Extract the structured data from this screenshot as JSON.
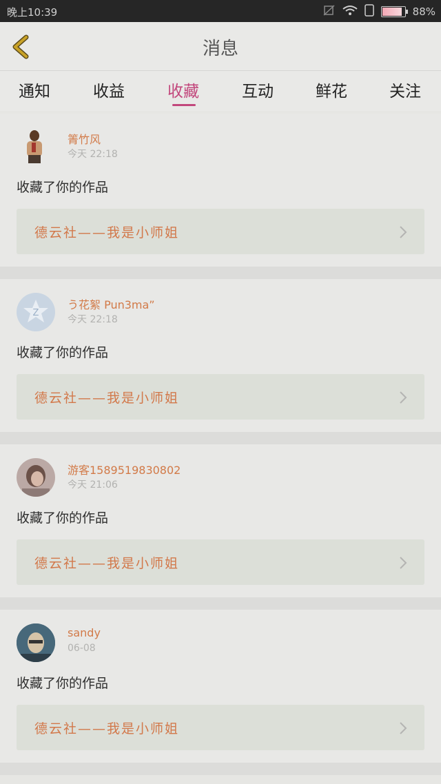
{
  "status_bar": {
    "time": "晚上10:39",
    "battery": "88%",
    "battery_level": 0.88
  },
  "header": {
    "title": "消息"
  },
  "tabs": [
    {
      "label": "通知"
    },
    {
      "label": "收益"
    },
    {
      "label": "收藏",
      "active": true
    },
    {
      "label": "互动"
    },
    {
      "label": "鲜花"
    },
    {
      "label": "关注"
    }
  ],
  "messages": [
    {
      "user": "箐竹风",
      "time": "今天 22:18",
      "action": "收藏了你的作品",
      "work": "德云社——我是小师姐"
    },
    {
      "user": "う花絮 Pun3ma”",
      "time": "今天 22:18",
      "action": "收藏了你的作品",
      "work": "德云社——我是小师姐"
    },
    {
      "user": "游客15895198308​02",
      "time": "今天 21:06",
      "action": "收藏了你的作品",
      "work": "德云社——我是小师姐"
    },
    {
      "user": "sandy",
      "time": "06-08",
      "action": "收藏了你的作品",
      "work": "德云社——我是小师姐"
    }
  ],
  "colors": {
    "accent": "#c2477c",
    "username": "#d27a48",
    "back_arrow": "#c9a227"
  }
}
